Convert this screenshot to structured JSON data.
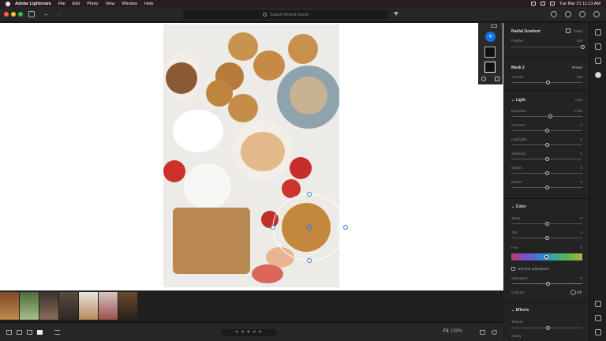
{
  "menubar": {
    "app": "Adobe Lightroom",
    "items": [
      "File",
      "Edit",
      "Photo",
      "View",
      "Window",
      "Help"
    ],
    "datetime": "Tue Mar 21  11:13 AM"
  },
  "toolbar": {
    "search_placeholder": "Search Recent Import"
  },
  "mask_panel": {
    "add_symbol": "+"
  },
  "bottombar": {
    "stars": "★★★★★",
    "fit_label": "Fit",
    "zoom_label": "100%"
  },
  "edit_panel": {
    "tool_title": "Radial Gradient",
    "invert_label": "Invert",
    "feather_label": "Feather",
    "feather_value": "100",
    "feather_level": 1.0,
    "mask_title": "Mask 2",
    "preset_label": "Preset",
    "amount_label": "Amount",
    "amount_value": "100",
    "light": {
      "title": "Light",
      "auto": "Auto",
      "sliders": [
        {
          "label": "Exposure",
          "value": "+0.55",
          "level": 0.55
        },
        {
          "label": "Contrast",
          "value": "0",
          "level": 0.5
        },
        {
          "label": "Highlights",
          "value": "0",
          "level": 0.5
        },
        {
          "label": "Shadows",
          "value": "0",
          "level": 0.5
        },
        {
          "label": "Whites",
          "value": "0",
          "level": 0.5
        },
        {
          "label": "Blacks",
          "value": "0",
          "level": 0.5
        }
      ]
    },
    "color": {
      "title": "Color",
      "sliders": [
        {
          "label": "Temp",
          "value": "0",
          "level": 0.5
        },
        {
          "label": "Tint",
          "value": "0",
          "level": 0.5
        }
      ],
      "hue_label": "Hue",
      "hue_value": "0",
      "fine_adjust_label": "Use fine adjustment",
      "saturation_label": "Saturation",
      "saturation_value": "0",
      "colorize_label": "Colorize",
      "colorize_state": "Off"
    },
    "effects": {
      "title": "Effects",
      "texture_label": "Texture",
      "clarity_label": "Clarity"
    }
  },
  "colors": {
    "accent": "#1473e6",
    "panel": "#232323"
  }
}
